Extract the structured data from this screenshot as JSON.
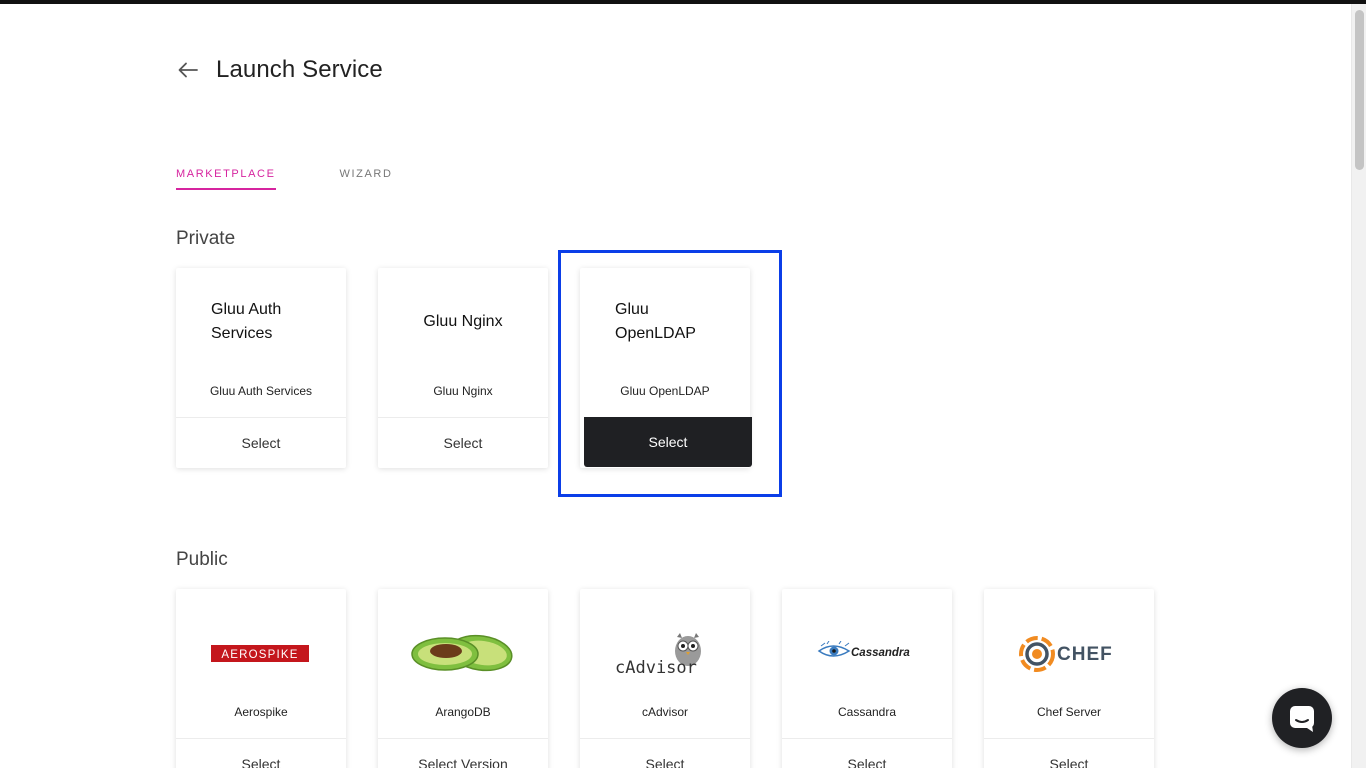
{
  "page": {
    "title": "Launch Service",
    "back_icon": "arrow-left-icon"
  },
  "tabs": [
    {
      "label": "MARKETPLACE",
      "active": true
    },
    {
      "label": "WIZARD",
      "active": false
    }
  ],
  "colors": {
    "accent": "#d6249f",
    "selected_button": "#1f2023",
    "focus_ring": "#0b3ee8"
  },
  "private": {
    "title": "Private",
    "cards": [
      {
        "heading": "Gluu Auth Services",
        "name": "Gluu Auth Services",
        "button": "Select"
      },
      {
        "heading": "Gluu Nginx",
        "name": "Gluu Nginx",
        "button": "Select"
      },
      {
        "heading": "Gluu OpenLDAP",
        "name": "Gluu OpenLDAP",
        "button": "Select",
        "selected": true
      }
    ]
  },
  "public": {
    "title": "Public",
    "cards": [
      {
        "logo": "aerospike-logo",
        "logo_text": "AEROSPIKE",
        "name": "Aerospike",
        "button": "Select"
      },
      {
        "logo": "arangodb-avocado-logo",
        "name": "ArangoDB",
        "button": "Select Version"
      },
      {
        "logo": "cadvisor-owl-logo",
        "logo_text": "cAdvisor",
        "name": "cAdvisor",
        "button": "Select"
      },
      {
        "logo": "cassandra-eye-logo",
        "logo_text": "Cassandra",
        "name": "Cassandra",
        "button": "Select"
      },
      {
        "logo": "chef-logo",
        "logo_text": "CHEF",
        "name": "Chef Server",
        "button": "Select"
      }
    ]
  },
  "chat": {
    "icon": "chat-bubble-icon"
  }
}
